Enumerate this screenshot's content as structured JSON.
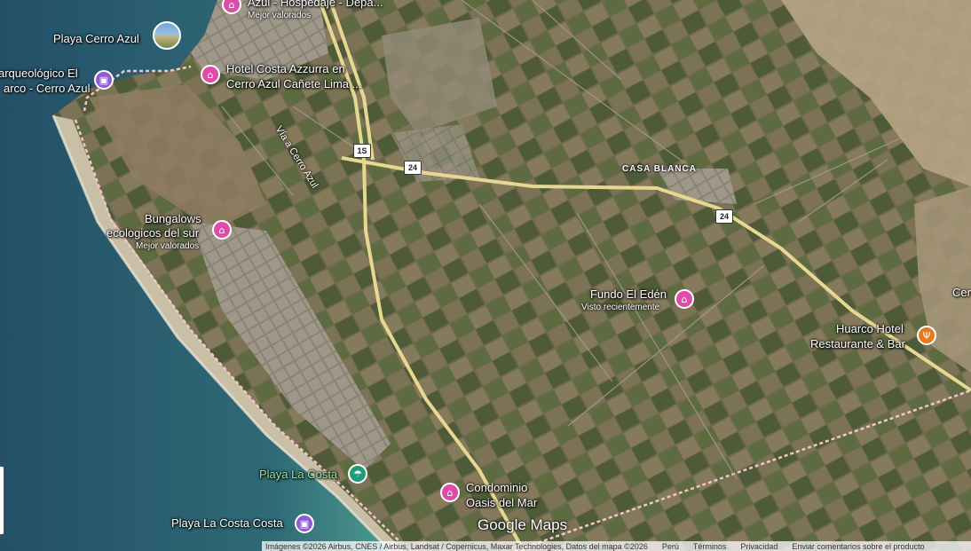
{
  "map": {
    "colors": {
      "ocean_deep": "#2e5c70",
      "ocean_shallow": "#3e8a86",
      "sand": "#b8a98a",
      "farmland": "#6e6a4e",
      "highway": "#e8dc9a",
      "border": "#f0b8c0"
    }
  },
  "places": {
    "playa_cerro_azul": "Playa Cerro Azul",
    "arqueologico_line1": "arqueológico El",
    "arqueologico_line2": "arco - Cerro Azul",
    "hospedaje_line1": "Azul - Hospedaje - Depa...",
    "hospedaje_sub": "Mejor valorados",
    "hotel_costa_line1": "Hotel Costa Azzurra en",
    "hotel_costa_line2": "Cerro Azul Cañete Lima ...",
    "via_cerro_azul": "Vía a Cerro Azul",
    "casa_blanca": "CASA BLANCA",
    "bungalows_line1": "Bungalows",
    "bungalows_line2": "ecologicos del sur",
    "bungalows_sub": "Mejor valorados",
    "fundo_eden": "Fundo El Edén",
    "fundo_eden_sub": "Visto recientemente",
    "huarco_line1": "Huarco Hotel",
    "huarco_line2": "Restaurante & Bar",
    "cer_partial": "Cer",
    "playa_la_costa": "Playa La Costa",
    "condominio_line1": "Condominio",
    "condominio_line2": "Oasis del Mar",
    "playa_la_costa_costa": "Playa La Costa Costa"
  },
  "roads": {
    "shield_1s": "1S",
    "shield_24a": "24",
    "shield_24b": "24"
  },
  "footer": {
    "logo": "Google Maps",
    "imagery": "Imágenes ©2026 Airbus, CNES / Airbus, Landsat / Copernicus, Maxar Technologies, Datos del mapa ©2026",
    "country": "Perú",
    "terms": "Términos",
    "privacy": "Privacidad",
    "feedback": "Enviar comentarios sobre el producto"
  },
  "icons": {
    "lodging": "bed-icon",
    "museum": "museum-icon",
    "restaurant": "fork-knife-icon",
    "beach": "umbrella-icon"
  }
}
